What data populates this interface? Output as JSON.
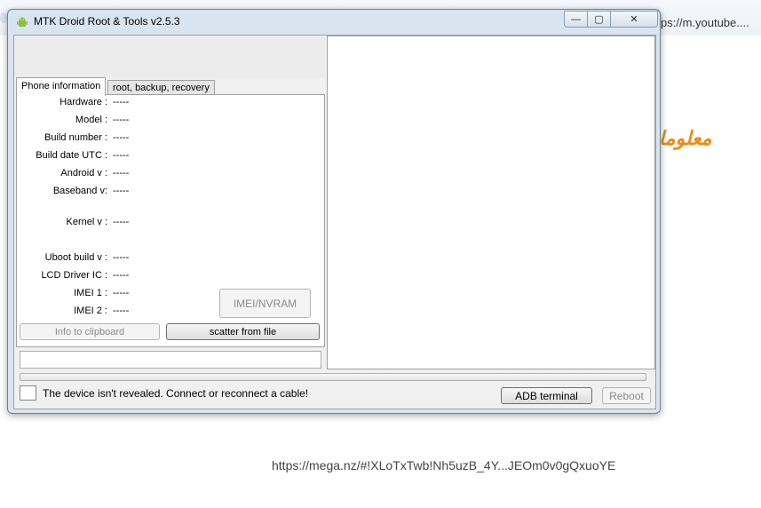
{
  "background": {
    "url_fragment": "ps://m.youtube....",
    "arabic_text": "معلوما",
    "link": "https://mega.nz/#!XLoTxTwb!Nh5uzB_4Y...JEOm0v0gQxuoYE"
  },
  "window": {
    "title": "MTK Droid Root & Tools v2.5.3",
    "controls": {
      "minimize": "—",
      "maximize": "▢",
      "close": "✕"
    }
  },
  "tabs": [
    {
      "label": "Phone information",
      "active": true
    },
    {
      "label": "root, backup, recovery",
      "active": false
    }
  ],
  "info": {
    "hardware": {
      "label": "Hardware :",
      "value": "-----"
    },
    "model": {
      "label": "Model :",
      "value": "-----"
    },
    "build_number": {
      "label": "Build number :",
      "value": "-----"
    },
    "build_date": {
      "label": "Build date UTC :",
      "value": "-----"
    },
    "android": {
      "label": "Android  v :",
      "value": "-----"
    },
    "baseband": {
      "label": "Baseband v:",
      "value": "-----"
    },
    "kernel": {
      "label": "Kernel v :",
      "value": "-----"
    },
    "uboot": {
      "label": "Uboot build v :",
      "value": "-----"
    },
    "lcd": {
      "label": "LCD Driver IC :",
      "value": "-----"
    },
    "imei1": {
      "label": "IMEI 1 :",
      "value": "-----"
    },
    "imei2": {
      "label": "IMEI 2 :",
      "value": "-----"
    }
  },
  "buttons": {
    "imei_nvram": "IMEI/NVRAM",
    "info_clipboard": "Info to clipboard",
    "scatter": "scatter from file",
    "adb_terminal": "ADB terminal",
    "reboot": "Reboot"
  },
  "status": "The device isn't revealed. Connect or reconnect a cable!",
  "colors": {
    "accent_orange": "#f08a12",
    "window_frame": "#d9e4f1"
  }
}
